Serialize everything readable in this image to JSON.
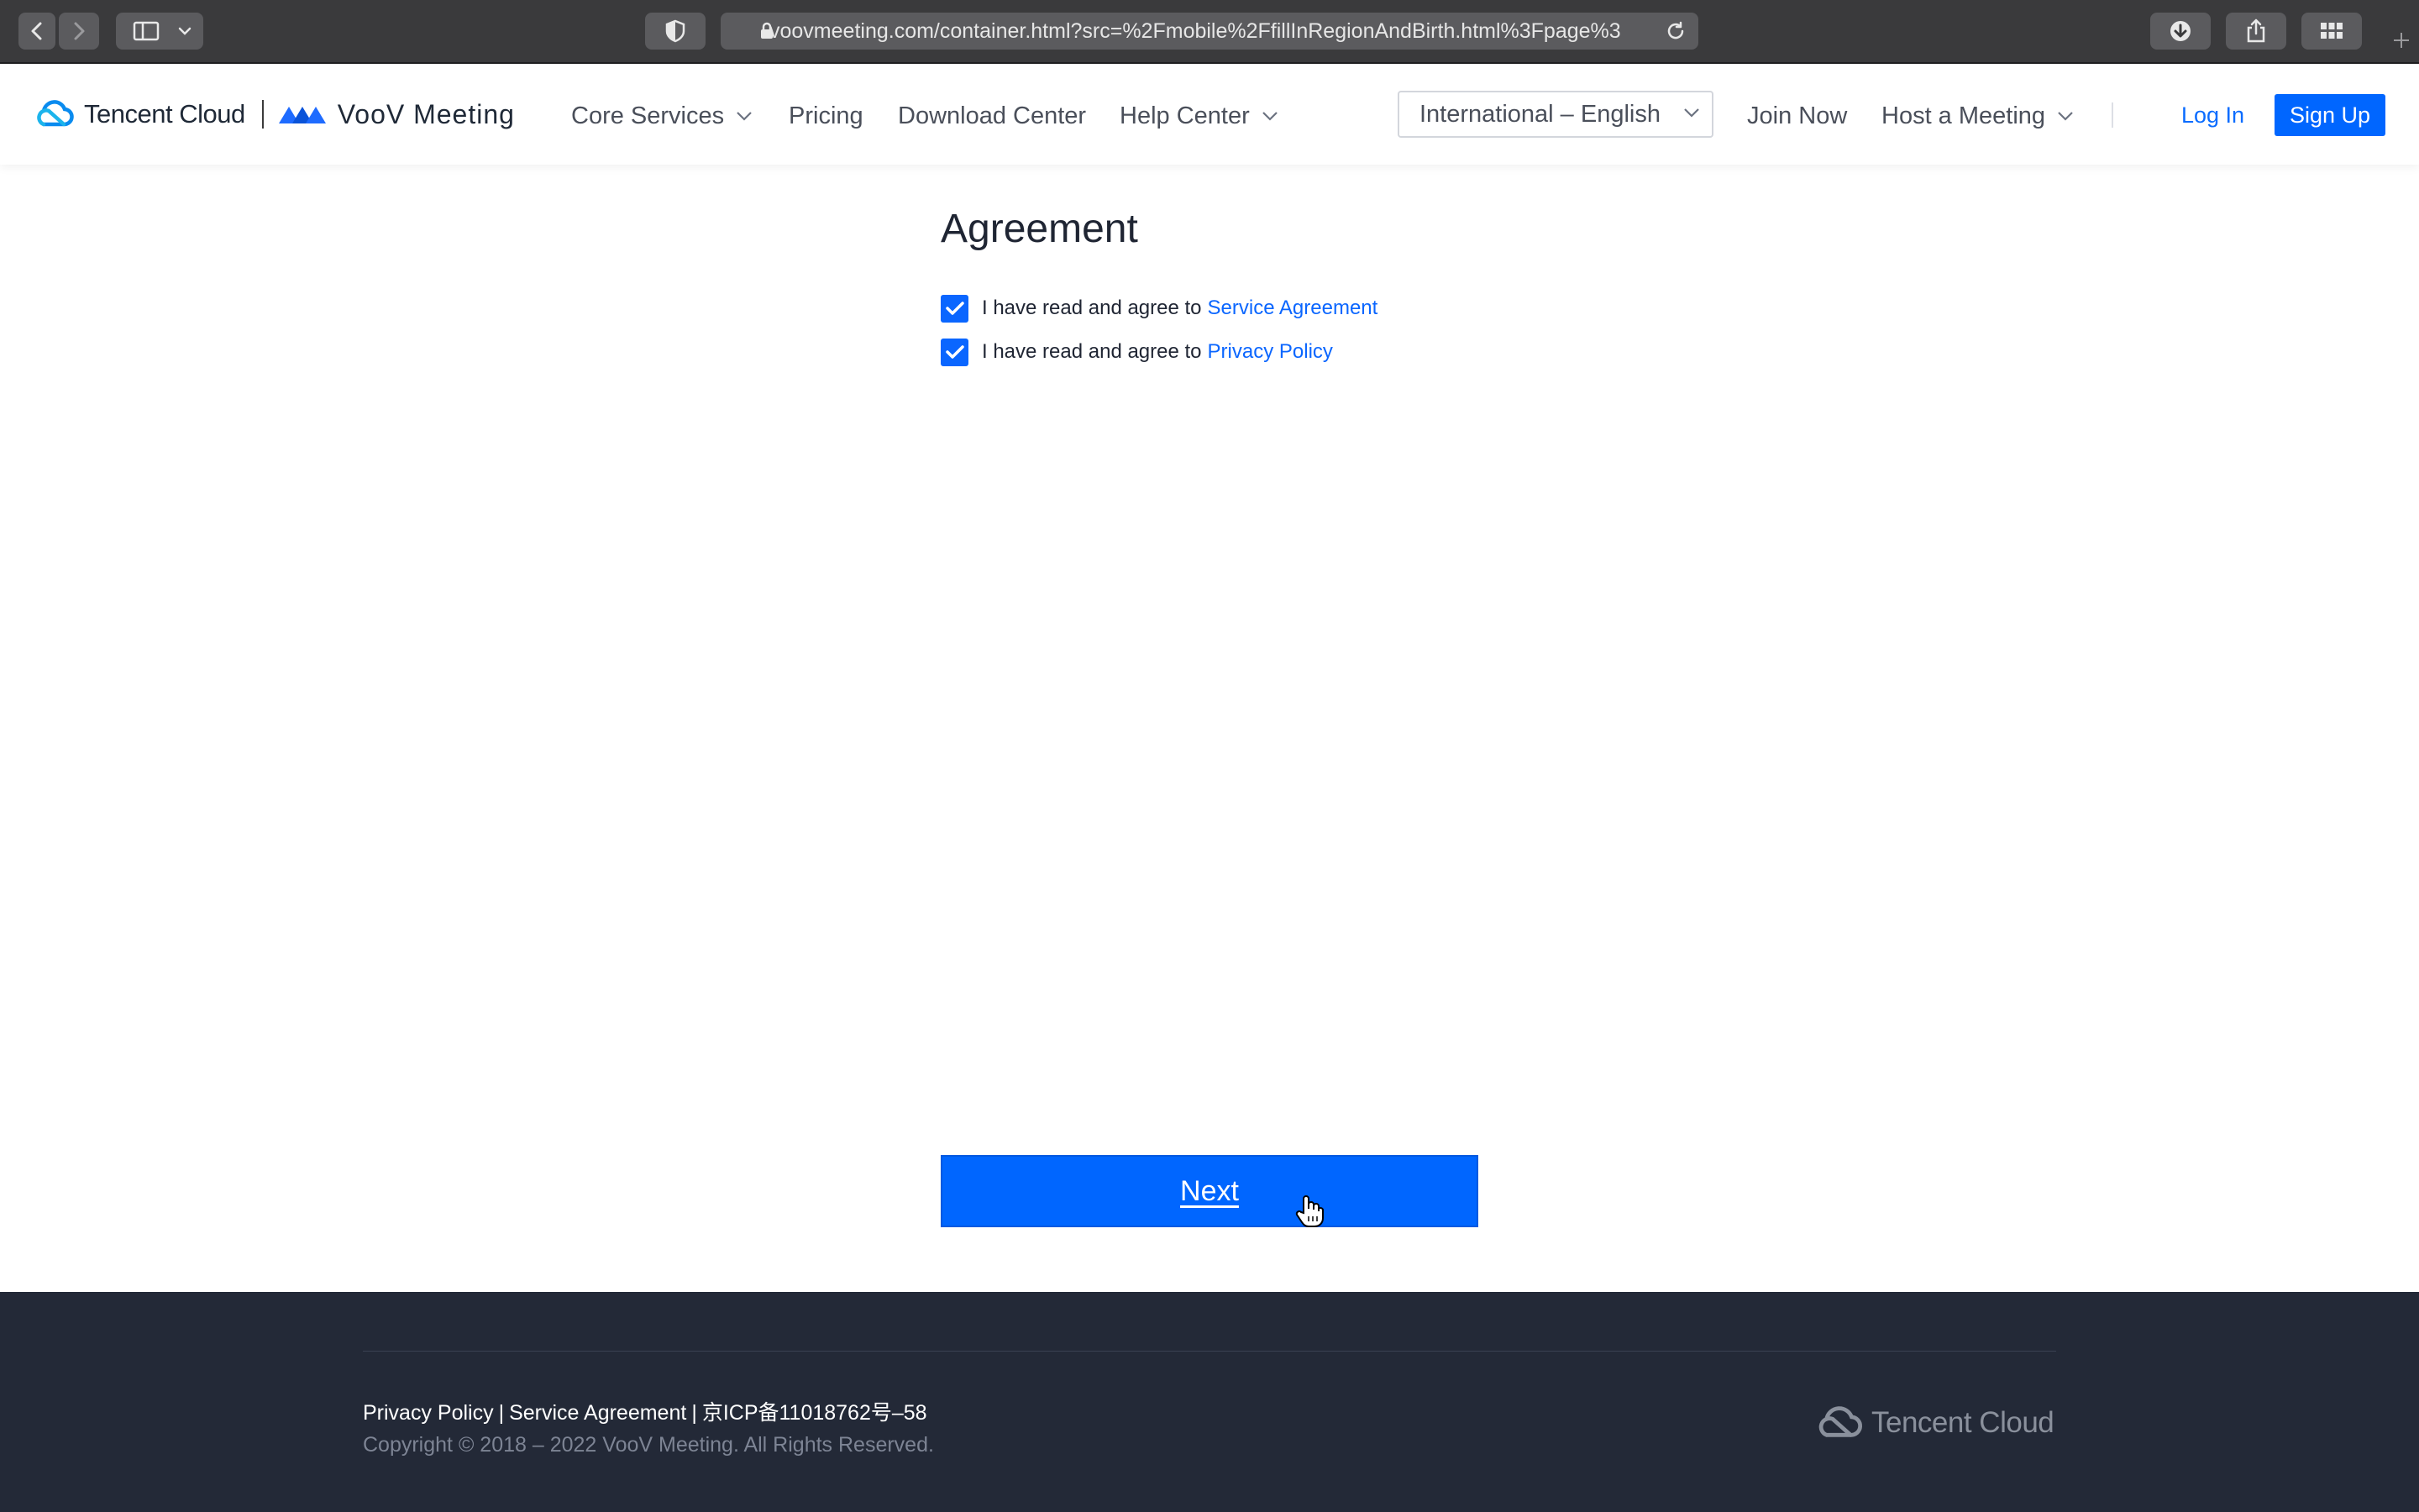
{
  "browser": {
    "url": "voovmeeting.com/container.html?src=%2Fmobile%2FfillInRegionAndBirth.html%3Fpage%3"
  },
  "header": {
    "tencent_brand": "Tencent Cloud",
    "voov_brand": "VooV Meeting",
    "nav": {
      "core_services": "Core Services",
      "pricing": "Pricing",
      "download_center": "Download Center",
      "help_center": "Help Center"
    },
    "language": "International – English",
    "join_now": "Join Now",
    "host_meeting": "Host a Meeting",
    "log_in": "Log In",
    "sign_up": "Sign Up"
  },
  "main": {
    "title": "Agreement",
    "agreements": [
      {
        "prefix": "I have read and agree to",
        "link": "Service Agreement",
        "checked": true
      },
      {
        "prefix": "I have read and agree to",
        "link": "Privacy Policy",
        "checked": true
      }
    ],
    "next_label": "Next"
  },
  "footer": {
    "privacy": "Privacy Policy",
    "service": "Service Agreement",
    "icp": "京ICP备11018762号–58",
    "separator": "|",
    "copyright": "Copyright © 2018 – 2022 VooV Meeting. All Rights Reserved.",
    "brand": "Tencent Cloud"
  },
  "colors": {
    "accent": "#0066ff",
    "footer_bg": "#232937",
    "chrome_bg": "#3a3a3c"
  }
}
